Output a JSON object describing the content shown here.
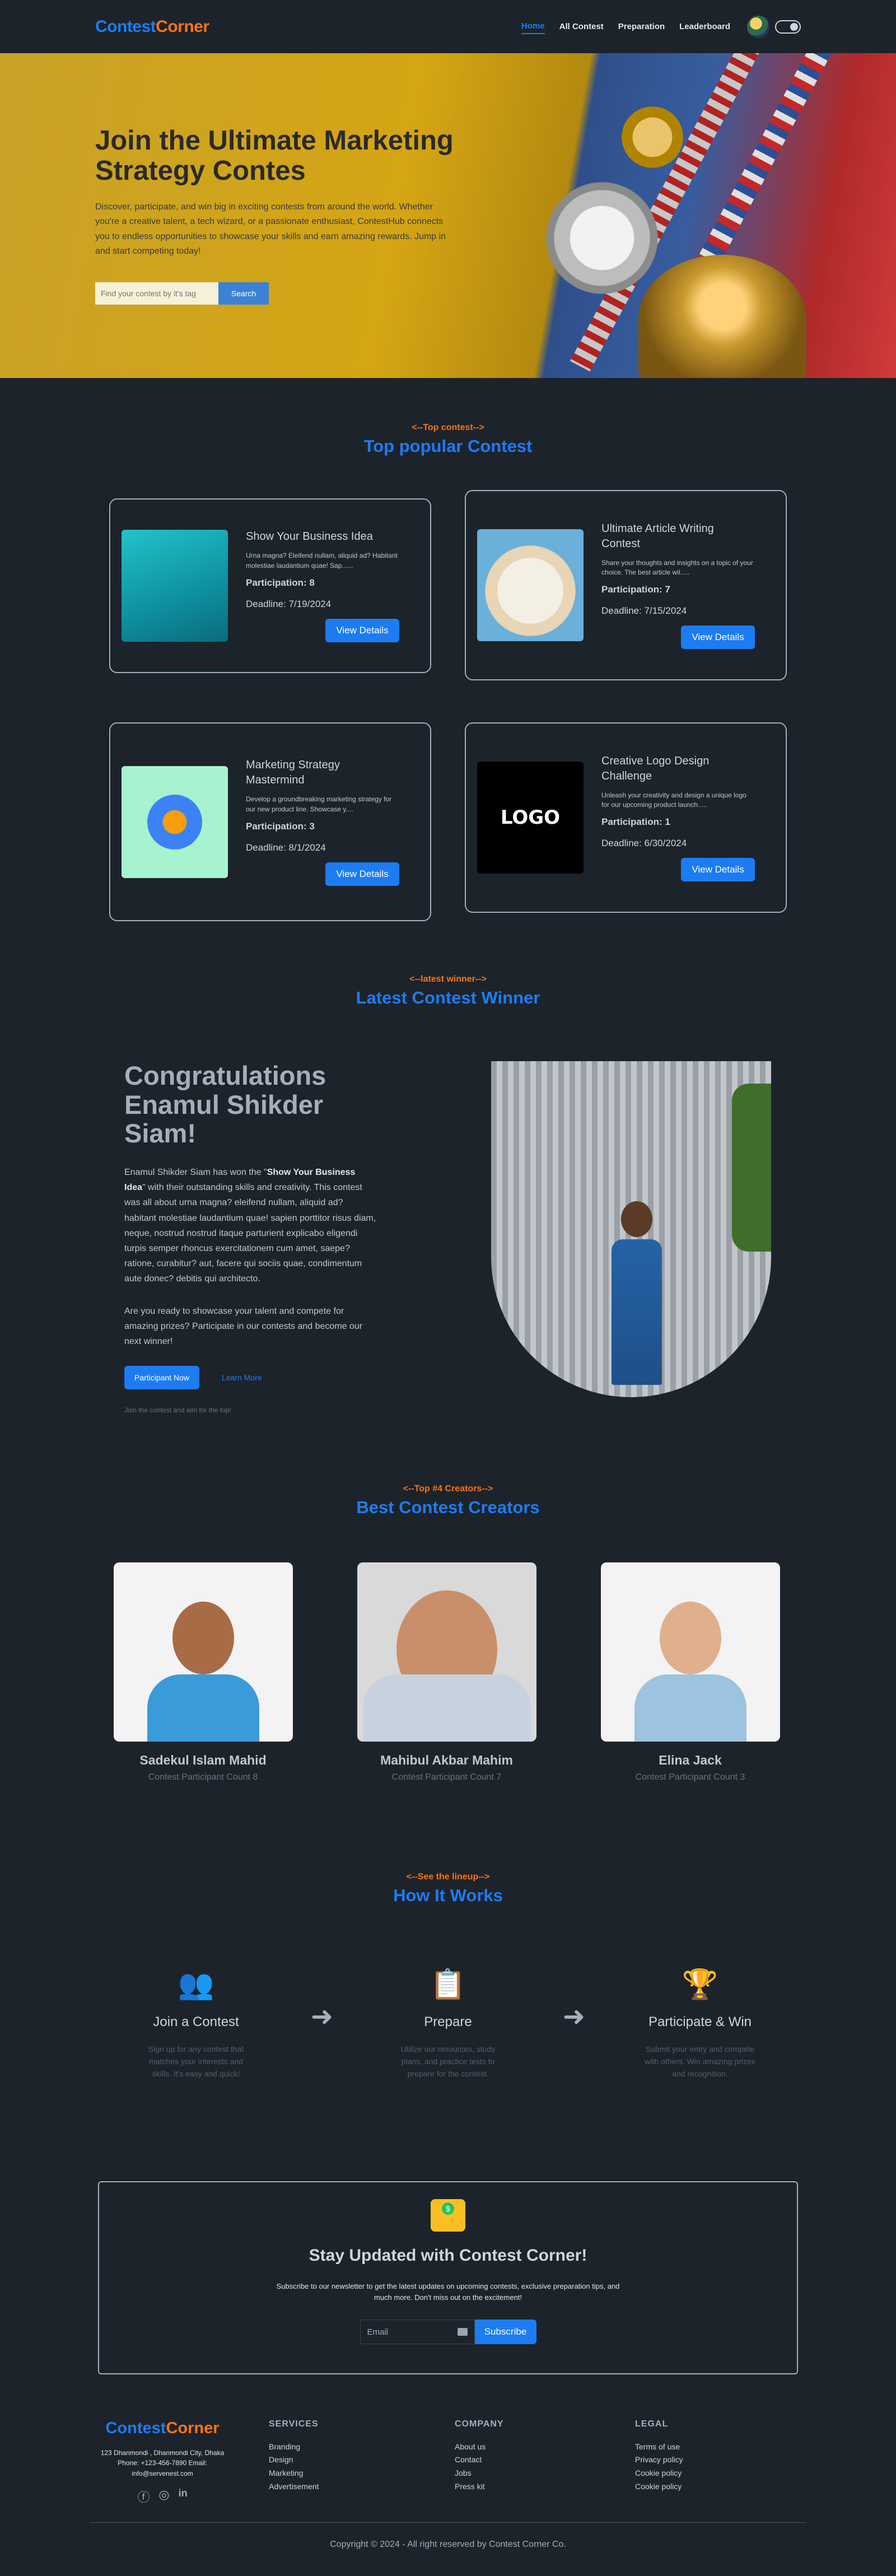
{
  "nav": {
    "logo_part1": "Contest",
    "logo_part2": "Corner",
    "links": [
      "Home",
      "All Contest",
      "Preparation",
      "Leaderboard"
    ]
  },
  "hero": {
    "title": "Join the Ultimate Marketing Strategy Contes",
    "description": "Discover, participate, and win big in exciting contests from around the world. Whether you're a creative talent, a tech wizard, or a passionate enthusiast, ContestHub connects you to endless opportunities to showcase your skills and earn amazing rewards. Jump in and start competing today!",
    "search_placeholder": "Find your contest by it's tag",
    "search_button": "Search"
  },
  "contests": {
    "tag": "<--Top contest-->",
    "title": "Top popular Contest",
    "view_label": "View Details",
    "items": [
      {
        "title": "Show Your Business Idea",
        "desc": "Urna magna? Eleifend nullam, aliquid ad? Habitant molestiae laudantium quae! Sap......",
        "participation": "Participation: 8",
        "deadline": "Deadline: 7/19/2024"
      },
      {
        "title": "Ultimate Article Writing Contest",
        "desc": "Share your thoughts and insights on a topic of your choice. The best article wil.....",
        "participation": "Participation: 7",
        "deadline": "Deadline: 7/15/2024"
      },
      {
        "title": "Marketing Strategy Mastermind",
        "desc": "Develop a groundbreaking marketing strategy for our new product line. Showcase y....",
        "participation": "Participation: 3",
        "deadline": "Deadline: 8/1/2024"
      },
      {
        "title": "Creative Logo Design Challenge",
        "desc": "Unleash your creativity and design a unique logo for our upcoming product launch.....",
        "participation": "Participation: 1",
        "deadline": "Deadline: 6/30/2024"
      }
    ]
  },
  "winner": {
    "tag": "<--latest winner-->",
    "title": "Latest Contest Winner",
    "heading": "Congratulations Enamul Shikder Siam!",
    "p1_start": "Enamul Shikder Siam has won the \"",
    "p1_bold": "Show Your Business Idea",
    "p1_end": "\" with their outstanding skills and creativity. This contest was all about urna magna? eleifend nullam, aliquid ad? habitant molestiae laudantium quae! sapien porttitor risus diam, neque, nostrud nostrud itaque parturient explicabo eligendi turpis semper rhoncus exercitationem cum amet, saepe? ratione, curabitur? aut, facere qui sociis quae, condimentum aute donec? debitis qui architecto.",
    "p2": "Are you ready to showcase your talent and compete for amazing prizes? Participate in our contests and become our next winner!",
    "btn_primary": "Participant Now",
    "btn_link": "Learn More",
    "note": "Join the contest and aim for the top!"
  },
  "creators": {
    "tag": "<--Top #4 Creators-->",
    "title": "Best Contest Creators",
    "items": [
      {
        "name": "Sadekul Islam Mahid",
        "count": "Contest Participant Count 8"
      },
      {
        "name": "Mahibul Akbar Mahim",
        "count": "Contest Participant Count 7"
      },
      {
        "name": "Elina Jack",
        "count": "Contest Participant Count 3"
      }
    ]
  },
  "how": {
    "tag": "<--See the lineup-->",
    "title": "How It Works",
    "steps": [
      {
        "icon": "team-icon",
        "title": "Join a Contest",
        "desc": "Sign up for any contest that matches your interests and skills. It's easy and quick!"
      },
      {
        "icon": "study-icon",
        "title": "Prepare",
        "desc": "Utilize our resources, study plans, and practice tests to prepare for the contest."
      },
      {
        "icon": "trophy-icon",
        "title": "Participate & Win",
        "desc": "Submit your entry and compete with others. Win amazing prizes and recognition."
      }
    ]
  },
  "newsletter": {
    "title": "Stay Updated with Contest Corner!",
    "desc": "Subscribe to our newsletter to get the latest updates on upcoming contests, exclusive preparation tips, and much more. Don't miss out on the excitement!",
    "email_placeholder": "Email",
    "button": "Subscribe"
  },
  "footer": {
    "logo_part1": "Contest",
    "logo_part2": "Corner",
    "address": "123 Dhanmondi , Dhanmondi City, Dhaka Phone: +123-456-7890 Email: info@servenest.com",
    "services": {
      "title": "SERVICES",
      "items": [
        "Branding",
        "Design",
        "Marketing",
        "Advertisement"
      ]
    },
    "company": {
      "title": "COMPANY",
      "items": [
        "About us",
        "Contact",
        "Jobs",
        "Press kit"
      ]
    },
    "legal": {
      "title": "LEGAL",
      "items": [
        "Terms of use",
        "Privacy policy",
        "Cookie policy",
        "Cookie policy"
      ]
    },
    "copyright": "Copyright © 2024 - All right reserved by Contest Corner Co."
  },
  "colors": {
    "accent": "#1d7cf2",
    "orange": "#f97316",
    "bg": "#1d232a"
  }
}
